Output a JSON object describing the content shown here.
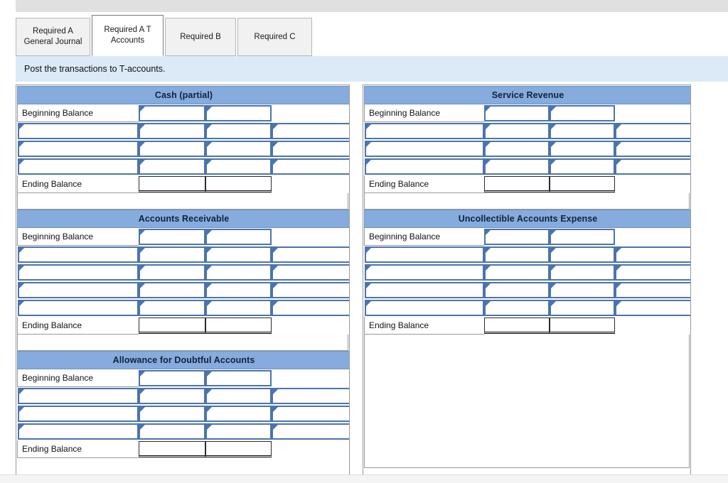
{
  "window": {
    "title": "Required A T Accounts"
  },
  "tabs": [
    {
      "label": "Required A General Journal",
      "active": false
    },
    {
      "label": "Required A T Accounts",
      "active": true
    },
    {
      "label": "Required B",
      "active": false
    },
    {
      "label": "Required C",
      "active": false
    }
  ],
  "instruction": {
    "text": "Post the transactions to T-accounts."
  },
  "labels": {
    "beginning_balance": "Beginning Balance",
    "ending_balance": "Ending Balance"
  },
  "colors": {
    "account_header_bg": "#86ACDE",
    "instruction_bg": "#dbeaf6",
    "input_border": "#4B74AE",
    "topbar_bg": "#e0e0e0",
    "active_tab_bg": "#ffffff",
    "inactive_tab_bg": "#f1f1f1"
  },
  "left_panel": {
    "accounts": [
      {
        "name": "Cash (partial)",
        "beginning_balance": {
          "debit": "",
          "credit": ""
        },
        "entries": [
          {
            "description": "",
            "debit": "",
            "credit": "",
            "extra": ""
          },
          {
            "description": "",
            "debit": "",
            "credit": "",
            "extra": ""
          },
          {
            "description": "",
            "debit": "",
            "credit": "",
            "extra": ""
          }
        ],
        "ending_balance": {
          "debit": "",
          "credit": ""
        }
      },
      {
        "name": "Accounts Receivable",
        "beginning_balance": {
          "debit": "",
          "credit": ""
        },
        "entries": [
          {
            "description": "",
            "debit": "",
            "credit": "",
            "extra": ""
          },
          {
            "description": "",
            "debit": "",
            "credit": "",
            "extra": ""
          },
          {
            "description": "",
            "debit": "",
            "credit": "",
            "extra": ""
          },
          {
            "description": "",
            "debit": "",
            "credit": "",
            "extra": ""
          }
        ],
        "ending_balance": {
          "debit": "",
          "credit": ""
        }
      },
      {
        "name": "Allowance for Doubtful Accounts",
        "beginning_balance": {
          "debit": "",
          "credit": ""
        },
        "entries": [
          {
            "description": "",
            "debit": "",
            "credit": "",
            "extra": ""
          },
          {
            "description": "",
            "debit": "",
            "credit": "",
            "extra": ""
          },
          {
            "description": "",
            "debit": "",
            "credit": "",
            "extra": ""
          }
        ],
        "ending_balance": {
          "debit": "",
          "credit": ""
        }
      }
    ]
  },
  "right_panel": {
    "accounts": [
      {
        "name": "Service Revenue",
        "beginning_balance": {
          "debit": "",
          "credit": ""
        },
        "entries": [
          {
            "description": "",
            "debit": "",
            "credit": "",
            "extra": ""
          },
          {
            "description": "",
            "debit": "",
            "credit": "",
            "extra": ""
          },
          {
            "description": "",
            "debit": "",
            "credit": "",
            "extra": ""
          }
        ],
        "ending_balance": {
          "debit": "",
          "credit": ""
        }
      },
      {
        "name": "Uncollectible Accounts Expense",
        "beginning_balance": {
          "debit": "",
          "credit": ""
        },
        "entries": [
          {
            "description": "",
            "debit": "",
            "credit": "",
            "extra": ""
          },
          {
            "description": "",
            "debit": "",
            "credit": "",
            "extra": ""
          },
          {
            "description": "",
            "debit": "",
            "credit": "",
            "extra": ""
          },
          {
            "description": "",
            "debit": "",
            "credit": "",
            "extra": ""
          }
        ],
        "ending_balance": {
          "debit": "",
          "credit": ""
        }
      }
    ]
  }
}
